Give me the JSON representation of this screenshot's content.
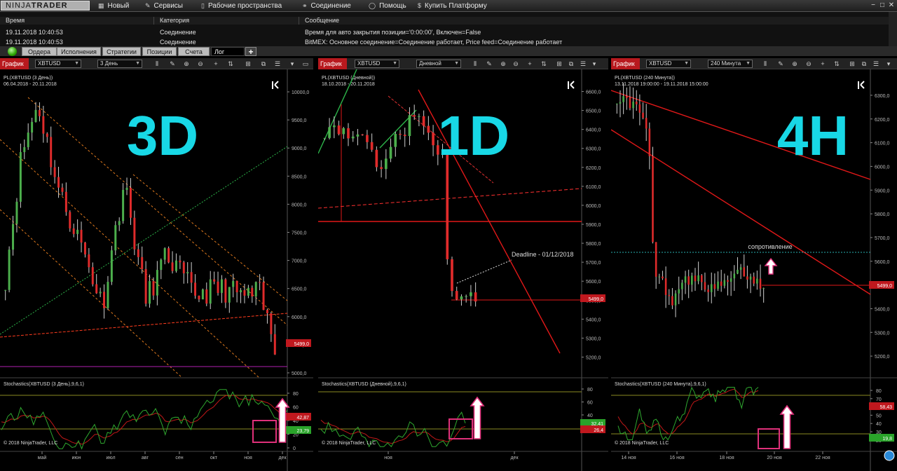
{
  "app": {
    "logo_light": "NINJA",
    "logo_bold": "TRADER"
  },
  "menu": {
    "items": [
      {
        "label": "Новый",
        "icon": "grid"
      },
      {
        "label": "Сервисы",
        "icon": "wrench"
      },
      {
        "label": "Рабочие пространства",
        "icon": "doc"
      },
      {
        "label": "Соединение",
        "icon": "plug"
      },
      {
        "label": "Помощь",
        "icon": "help"
      },
      {
        "label": "Купить Платформу",
        "icon": "dollar"
      }
    ]
  },
  "log": {
    "columns": [
      "Время",
      "Категория",
      "Сообщение"
    ],
    "rows": [
      {
        "time": "19.11.2018 10:40:53",
        "category": "Соединение",
        "message": "Время для авто закрытия позиции='0:00:00', Включен=False"
      },
      {
        "time": "19.11.2018 10:40:53",
        "category": "Соединение",
        "message": "BitMEX: Основное соединение=Соединение работает, Price feed=Соединение работает"
      }
    ]
  },
  "tabs": [
    "Ордера",
    "Исполнения",
    "Стратегии",
    "Позиции",
    "Счета",
    "Лог"
  ],
  "active_tab": "Лог",
  "charts": [
    {
      "title": "График",
      "instrument": "XBTUSD",
      "period": "3 День",
      "header": "PL(XBTUSD (3 День))",
      "range": "06.04.2018 - 20.11.2018",
      "overlay": "3D",
      "yticks": [
        "10000,0",
        "9500,0",
        "9000,0",
        "8500,0",
        "8000,0",
        "7500,0",
        "7000,0",
        "6500,0",
        "6000,0",
        "5500,0",
        "5000,0"
      ],
      "price_tag": "5499,0",
      "ind_header": "Stochastics(XBTUSD (3 День),9,6,1)",
      "ind_ticks": [
        "80",
        "60",
        "40",
        "20",
        "0"
      ],
      "ind_tags": [
        "42,87",
        "23,79"
      ],
      "copyright": "© 2018 NinjaTrader, LLC",
      "xticks": [
        "май",
        "июн",
        "июл",
        "авг",
        "сен",
        "окт",
        "ноя",
        "дек"
      ]
    },
    {
      "title": "График",
      "instrument": "XBTUSD",
      "period": "Дневной",
      "header": "PL(XBTUSD (Дневной))",
      "range": "18.10.2018 - 20.11.2018",
      "overlay": "1D",
      "yticks": [
        "6600,0",
        "6500,0",
        "6400,0",
        "6300,0",
        "6200,0",
        "6100,0",
        "6000,0",
        "5900,0",
        "5800,0",
        "5700,0",
        "5600,0",
        "5500,0",
        "5400,0",
        "5300,0",
        "5200,0"
      ],
      "price_tag": "5499,0",
      "annotation": "Deadline - 01/12/2018",
      "ind_header": "Stochastics(XBTUSD (Дневной),9,6,1)",
      "ind_ticks": [
        "80",
        "60",
        "40",
        "20"
      ],
      "ind_tags": [
        "32,41",
        "26,4"
      ],
      "copyright": "© 2018 NinjaTrader, LLC",
      "xticks": [
        "ноя",
        "дек"
      ]
    },
    {
      "title": "График",
      "instrument": "XBTUSD",
      "period": "240 Минута",
      "header": "PL(XBTUSD (240 Минута))",
      "range": "13.11.2018 19:00:00 - 19.11.2018 15:00:00",
      "overlay": "4H",
      "yticks": [
        "6300,0",
        "6200,0",
        "6100,0",
        "6000,0",
        "5900,0",
        "5800,0",
        "5700,0",
        "5600,0",
        "5500,0",
        "5400,0",
        "5300,0",
        "5200,0"
      ],
      "price_tag": "5499,0",
      "annotation": "сопротивление",
      "ind_header": "Stochastics(XBTUSD (240 Минута),9,6,1)",
      "ind_ticks": [
        "80",
        "70",
        "60",
        "50",
        "40",
        "30",
        "20"
      ],
      "ind_tags": [
        "58,43",
        "19,8"
      ],
      "copyright": "© 2018 NinjaTrader, LLC",
      "xticks": [
        "14 ноя",
        "16 ноя",
        "18 ноя",
        "20 ноя",
        "22 ноя"
      ]
    }
  ],
  "colors": {
    "bull": "#4caf4c",
    "bear": "#e02b2b",
    "accent": "#b8191e",
    "overlay": "#18d8e6",
    "highlight": "#e0307a"
  }
}
